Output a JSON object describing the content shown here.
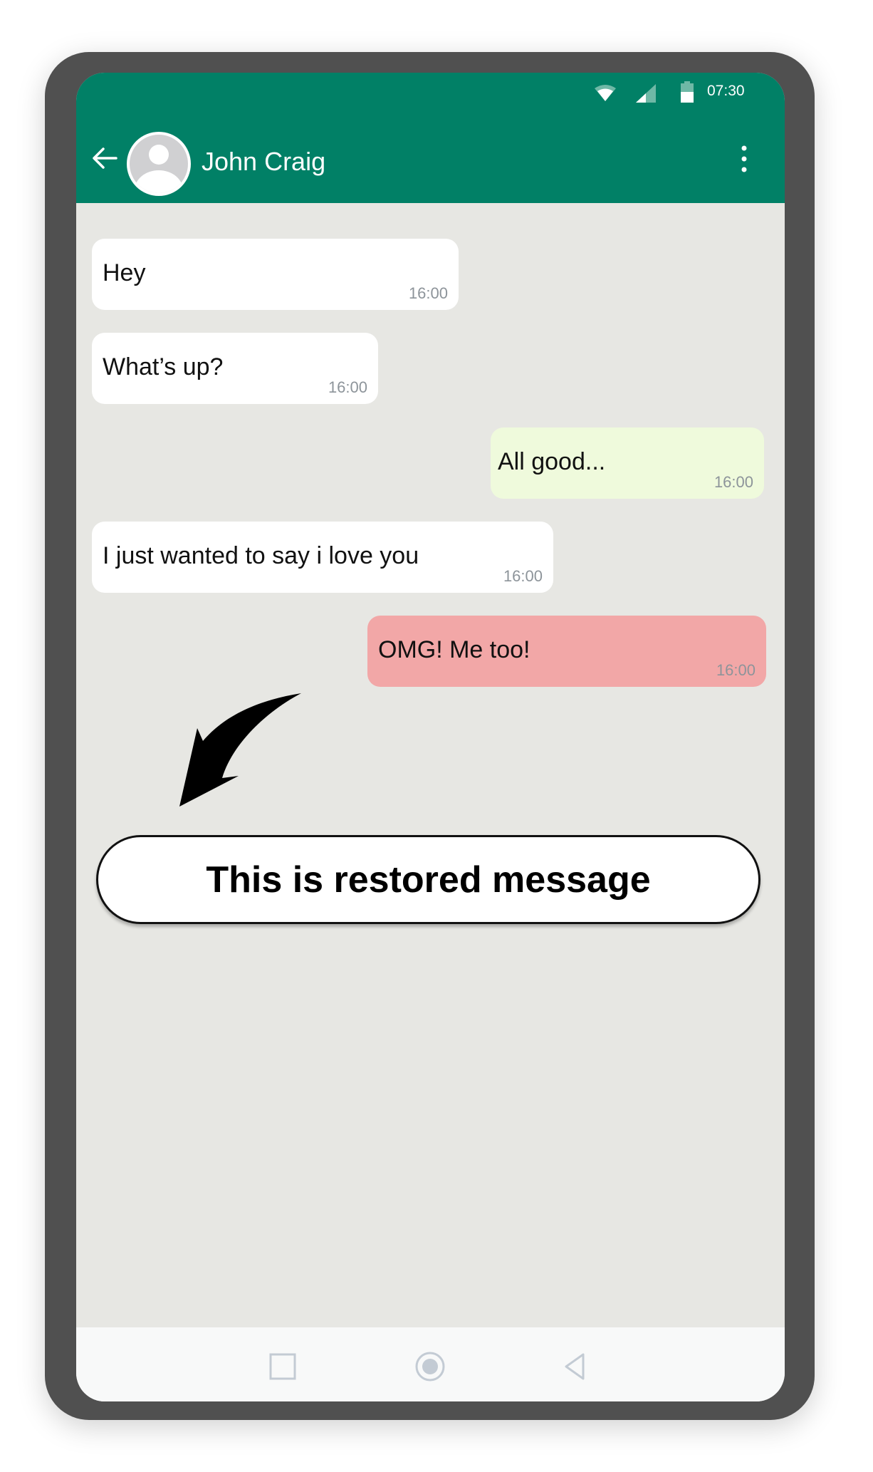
{
  "status_bar": {
    "time": "07:30",
    "icons": [
      "wifi-icon",
      "cellular-signal-icon",
      "battery-icon"
    ]
  },
  "header": {
    "contact_name": "John Craig",
    "back_icon": "arrow-left-icon",
    "avatar_icon": "default-avatar-icon",
    "menu_icon": "more-vertical-icon",
    "color": "#018066"
  },
  "messages": [
    {
      "direction": "incoming",
      "text": "Hey",
      "time": "16:00",
      "color": "#ffffff"
    },
    {
      "direction": "incoming",
      "text": "What’s up?",
      "time": "16:00",
      "color": "#ffffff"
    },
    {
      "direction": "outgoing",
      "text": "All good...",
      "time": "16:00",
      "color": "#effadc"
    },
    {
      "direction": "incoming",
      "text": "I just wanted to say i love you",
      "time": "16:00",
      "color": "#ffffff"
    },
    {
      "direction": "outgoing",
      "text": "OMG! Me too!",
      "time": "16:00",
      "color": "#f2a7a7"
    }
  ],
  "annotation": {
    "label": "This is restored message",
    "arrow_icon": "curved-arrow-down-left-icon"
  },
  "nav_bar": {
    "buttons": [
      "recents-square-icon",
      "home-circle-icon",
      "back-triangle-icon"
    ]
  }
}
